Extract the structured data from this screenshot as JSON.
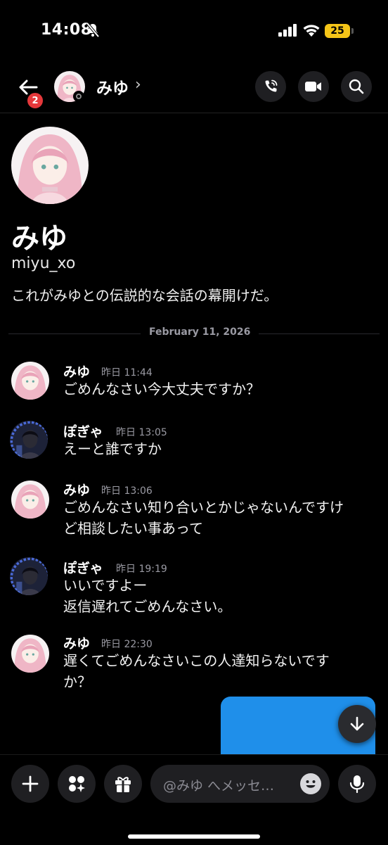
{
  "status_bar": {
    "time": "14:08",
    "battery": "25"
  },
  "header": {
    "unread_badge": "2",
    "name": "みゆ",
    "chevron": "›"
  },
  "profile": {
    "display_name": "みゆ",
    "username": "miyu_xo",
    "intro": "これがみゆとの伝説的な会話の幕開けだ。"
  },
  "date_separator": "February 11, 2026",
  "messages": [
    {
      "author": "みゆ",
      "timestamp": "昨日 11:44",
      "lines": [
        "ごめんなさい今大丈夫ですか？"
      ]
    },
    {
      "author": "ぽぎゃ",
      "timestamp": "昨日 13:05",
      "lines": [
        "えーと誰ですか"
      ]
    },
    {
      "author": "みゆ",
      "timestamp": "昨日 13:06",
      "lines": [
        "ごめんなさい知り合いとかじゃないんですけ",
        "ど相談したい事あって"
      ]
    },
    {
      "author": "ぽぎゃ",
      "timestamp": "昨日 19:19",
      "lines": [
        "いいですよー",
        "返信遅れてごめんなさい。"
      ]
    },
    {
      "author": "みゆ",
      "timestamp": "昨日 22:30",
      "lines": [
        "遅くてごめんなさいこの人達知らないです",
        "か？"
      ]
    }
  ],
  "composer": {
    "placeholder": "@みゆ へメッセ…"
  },
  "icons": {
    "back": "arrow-left-icon",
    "call": "phone-call-icon",
    "video": "video-camera-icon",
    "search": "search-icon",
    "add": "plus-icon",
    "apps": "apps-sparkle-icon",
    "gift": "gift-icon",
    "emoji": "emoji-icon",
    "mic": "microphone-icon",
    "scroll": "arrow-down-icon"
  },
  "colors": {
    "badge": "#e5383b",
    "battery": "#f5c518",
    "image_preview": "#1f8fea"
  }
}
